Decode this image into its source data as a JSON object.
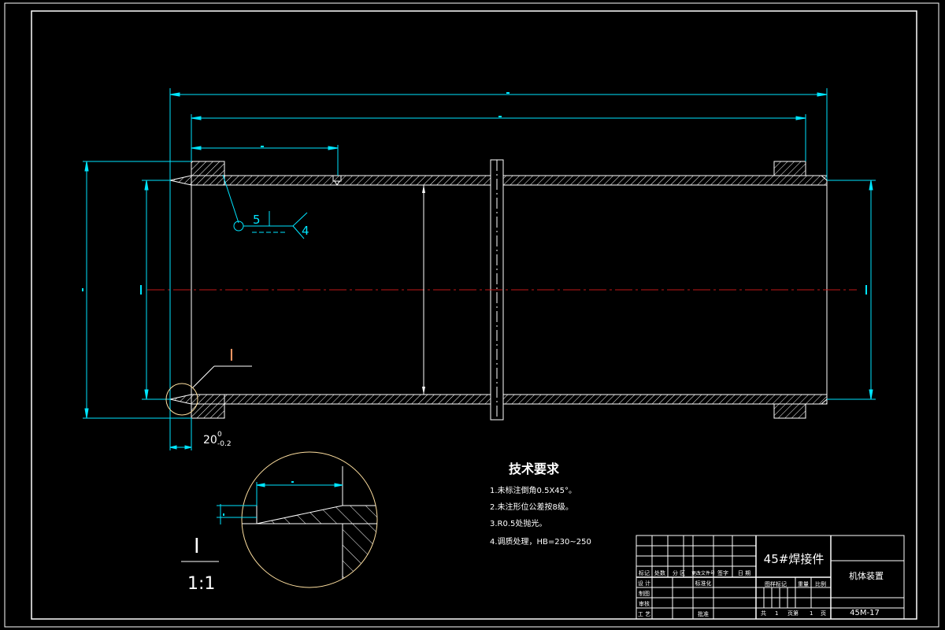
{
  "colors": {
    "background": "#000000",
    "border": "#ffffff",
    "dimension": "#00e5ff",
    "centerline": "#c01818",
    "detail_circle": "#ffe0a0",
    "callout": "#ff9a66",
    "text": "#ffffff"
  },
  "main_view": {
    "weld_symbol": {
      "number_left": "5",
      "number_right": "4"
    },
    "detail_callout": "I",
    "tolerance": {
      "nominal": "20",
      "upper": "0",
      "lower": "-0.2"
    }
  },
  "detail_view": {
    "label": "I",
    "scale": "1:1"
  },
  "technical_requirements": {
    "title": "技术要求",
    "items": [
      "1.未标注倒角0.5X45°。",
      "2.未注形位公差按8级。",
      "3.R0.5处抛光。",
      "4.调质处理，HB=230~250"
    ]
  },
  "title_block": {
    "part_name": "45#焊接件",
    "assembly_name": "机体装置",
    "drawing_number": "45M-17",
    "header_row": [
      "标记",
      "处数",
      "分 区",
      "更改文件号",
      "签字",
      "日 期"
    ],
    "row_labels": [
      "设 计",
      "制图",
      "审核",
      "工 艺"
    ],
    "standardization": "标准化",
    "approve": "批准",
    "stage_labels": [
      "图样标记",
      "重量",
      "比例"
    ],
    "sheets": {
      "total_label": "共",
      "total": "1",
      "sheet_label": "页第",
      "sheet": "1",
      "page_label": "页"
    }
  }
}
